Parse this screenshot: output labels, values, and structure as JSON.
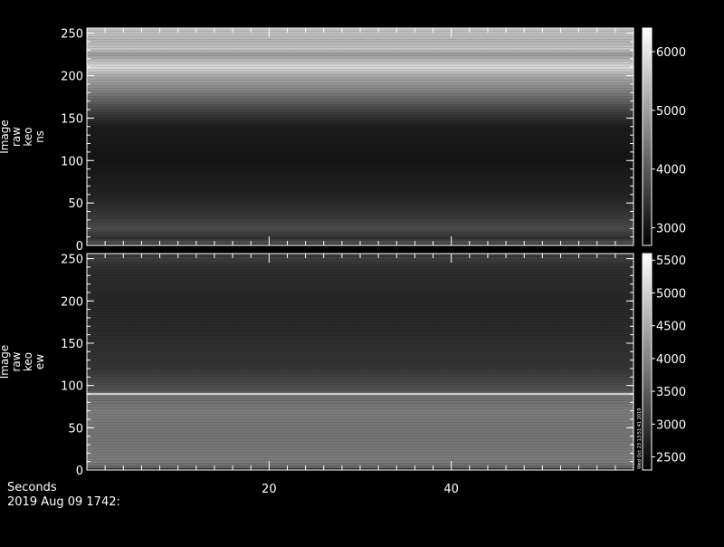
{
  "chart_data": [
    {
      "type": "heatmap",
      "panel": "top",
      "ylabel_lines": [
        "Image",
        "raw",
        "keo",
        "ns"
      ],
      "y_ticks": [
        0,
        50,
        100,
        150,
        200,
        250
      ],
      "ylim": [
        0,
        256
      ],
      "xlim": [
        0,
        60
      ],
      "x_ticks": [
        20,
        40
      ],
      "colorbar_ticks": [
        3000,
        4000,
        5000,
        6000
      ],
      "colorbar_range": [
        2700,
        6400
      ],
      "colormap": "grayscale",
      "row_profile": [
        {
          "y": 0,
          "value": 3300
        },
        {
          "y": 4,
          "value": 3900
        },
        {
          "y": 8,
          "value": 3400
        },
        {
          "y": 20,
          "value": 3800
        },
        {
          "y": 35,
          "value": 3500
        },
        {
          "y": 60,
          "value": 3200
        },
        {
          "y": 100,
          "value": 3000
        },
        {
          "y": 140,
          "value": 3100
        },
        {
          "y": 160,
          "value": 3700
        },
        {
          "y": 180,
          "value": 4500
        },
        {
          "y": 200,
          "value": 5200
        },
        {
          "y": 210,
          "value": 5900
        },
        {
          "y": 218,
          "value": 5400
        },
        {
          "y": 225,
          "value": 4900
        },
        {
          "y": 232,
          "value": 5600
        },
        {
          "y": 240,
          "value": 5300
        },
        {
          "y": 250,
          "value": 5500
        },
        {
          "y": 256,
          "value": 5400
        }
      ]
    },
    {
      "type": "heatmap",
      "panel": "bottom",
      "ylabel_lines": [
        "Image",
        "raw",
        "keo",
        "ew"
      ],
      "y_ticks": [
        0,
        50,
        100,
        150,
        200,
        250
      ],
      "ylim": [
        0,
        256
      ],
      "xlim": [
        0,
        60
      ],
      "x_ticks": [
        20,
        40
      ],
      "colorbar_ticks": [
        2500,
        3000,
        3500,
        4000,
        4500,
        5000,
        5500
      ],
      "colorbar_range": [
        2300,
        5600
      ],
      "colormap": "grayscale",
      "row_profile": [
        {
          "y": 0,
          "value": 2300
        },
        {
          "y": 3,
          "value": 3600
        },
        {
          "y": 10,
          "value": 3900
        },
        {
          "y": 40,
          "value": 3800
        },
        {
          "y": 70,
          "value": 3900
        },
        {
          "y": 88,
          "value": 3700
        },
        {
          "y": 90,
          "value": 5400
        },
        {
          "y": 92,
          "value": 3400
        },
        {
          "y": 120,
          "value": 3000
        },
        {
          "y": 160,
          "value": 2850
        },
        {
          "y": 200,
          "value": 2800
        },
        {
          "y": 240,
          "value": 2900
        },
        {
          "y": 250,
          "value": 3100
        },
        {
          "y": 256,
          "value": 3000
        }
      ]
    }
  ],
  "footer": {
    "x_axis_label": "Seconds",
    "date": "2019 Aug 09 1742:"
  },
  "stamp": "Wed Oct 23 13:51:41 2019"
}
